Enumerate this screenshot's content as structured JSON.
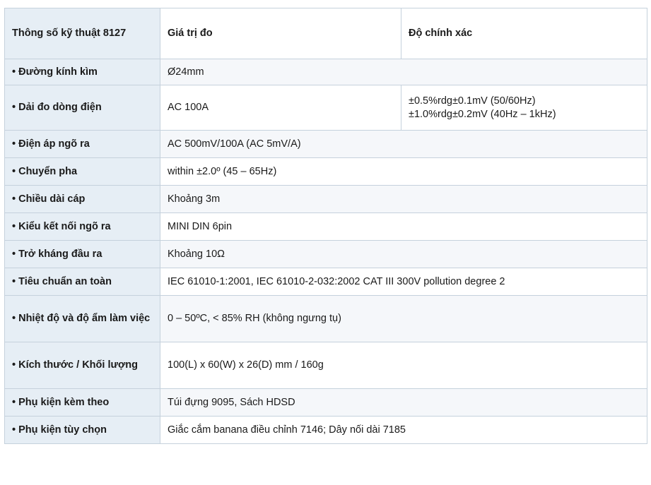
{
  "table": {
    "headers": [
      "Thông số kỹ thuật 8127",
      "Giá trị đo",
      "Độ chính xác"
    ],
    "rows": [
      {
        "label": "• Đường kính kìm",
        "value": "Ø24mm"
      },
      {
        "label": "• Dải đo dòng điện",
        "value": "AC 100A",
        "accuracy": [
          "±0.5%rdg±0.1mV (50/60Hz)",
          "±1.0%rdg±0.2mV (40Hz – 1kHz)"
        ]
      },
      {
        "label": "• Điện áp ngõ ra",
        "value": "AC 500mV/100A (AC 5mV/A)"
      },
      {
        "label": "• Chuyển pha",
        "value": "within ±2.0º (45 – 65Hz)"
      },
      {
        "label": "• Chiều dài cáp",
        "value": "Khoảng 3m"
      },
      {
        "label": "• Kiểu kết nối ngõ ra",
        "value": "MINI DIN 6pin"
      },
      {
        "label": "• Trở kháng đầu ra",
        "value": "Khoảng 10Ω"
      },
      {
        "label": "• Tiêu chuẩn an toàn",
        "value": "IEC 61010-1:2001, IEC 61010-2-032:2002 CAT III 300V pollution degree 2"
      },
      {
        "label": "• Nhiệt độ và độ ẩm làm việc",
        "value": "0 – 50ºC, < 85% RH (không ngưng tụ)"
      },
      {
        "label": "• Kích thước / Khối lượng",
        "value": "100(L) x 60(W) x 26(D) mm / 160g"
      },
      {
        "label": "• Phụ kiện kèm theo",
        "value": "Túi đựng 9095, Sách HDSD"
      },
      {
        "label": "• Phụ kiện tùy chọn",
        "value": "Giắc cắm banana điều chỉnh 7146; Dây nối dài 7185"
      }
    ]
  }
}
